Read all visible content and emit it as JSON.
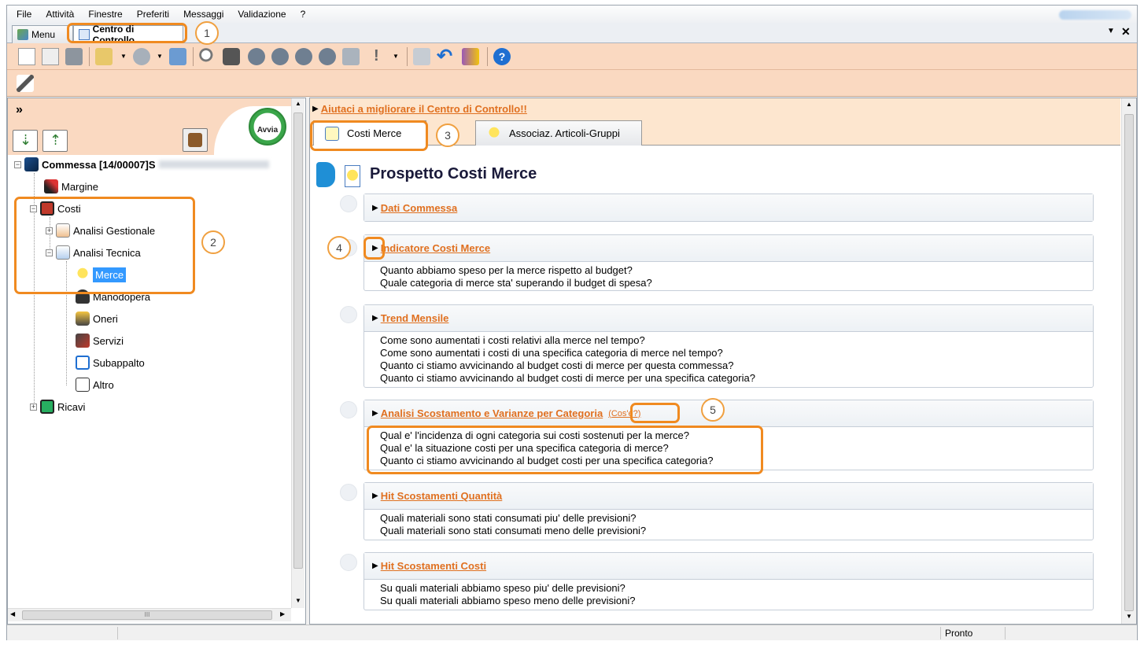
{
  "menu": [
    "File",
    "Attività",
    "Finestre",
    "Preferiti",
    "Messaggi",
    "Validazione",
    "?"
  ],
  "window_tabs": [
    {
      "label": "Menu"
    },
    {
      "label": "Centro di Controllo"
    }
  ],
  "left": {
    "avvia_label": "Avvia",
    "tree": {
      "root": "Commessa [14/00007]S",
      "margine": "Margine",
      "costi": "Costi",
      "analisi_gestionale": "Analisi Gestionale",
      "analisi_tecnica": "Analisi Tecnica",
      "merce": "Merce",
      "manodopera": "Manodopera",
      "oneri": "Oneri",
      "servizi": "Servizi",
      "subappalto": "Subappalto",
      "altro": "Altro",
      "ricavi": "Ricavi"
    },
    "hscroll_grip": "III"
  },
  "right": {
    "help_link": "Aiutaci a migliorare il Centro di Controllo!!",
    "tabs": [
      "Costi Merce",
      "Associaz. Articoli-Gruppi"
    ],
    "title": "Prospetto Costi Merce",
    "sections": [
      {
        "title": "Dati Commessa",
        "lines": []
      },
      {
        "title": "Indicatore Costi Merce",
        "lines": [
          "Quanto abbiamo speso per la merce rispetto al budget?",
          "Quale categoria di merce sta' superando il budget di spesa?"
        ]
      },
      {
        "title": "Trend Mensile",
        "lines": [
          "Come sono aumentati i costi relativi alla merce nel tempo?",
          "Come sono aumentati i costi di una specifica categoria di merce nel tempo?",
          "Quanto ci stiamo avvicinando al budget costi di merce per questa commessa?",
          "Quanto ci stiamo avvicinando al budget costi di merce per una specifica categoria?"
        ]
      },
      {
        "title": "Analisi Scostamento e Varianze per Categoria",
        "extra": "(Cos'é?)",
        "lines": [
          "Qual e' l'incidenza di ogni categoria sui costi sostenuti per la merce?",
          "Qual e' la situazione costi per una specifica categoria di merce?",
          "Quanto ci stiamo avvicinando al budget costi per una specifica categoria?"
        ]
      },
      {
        "title": "Hit Scostamenti Quantità",
        "lines": [
          "Quali materiali sono stati consumati piu' delle previsioni?",
          "Quali materiali sono stati consumati meno delle previsioni?"
        ]
      },
      {
        "title": "Hit Scostamenti Costi",
        "lines": [
          "Su quali materiali abbiamo speso piu' delle previsioni?",
          "Su quali materiali abbiamo speso meno delle previsioni?"
        ]
      }
    ]
  },
  "callouts": [
    "1",
    "2",
    "3",
    "4",
    "5"
  ],
  "status": {
    "text": "Pronto"
  },
  "colors": {
    "accent": "#f08a20",
    "toolbar": "#fad9c1",
    "link": "#e07020",
    "selection": "#3399ff"
  }
}
